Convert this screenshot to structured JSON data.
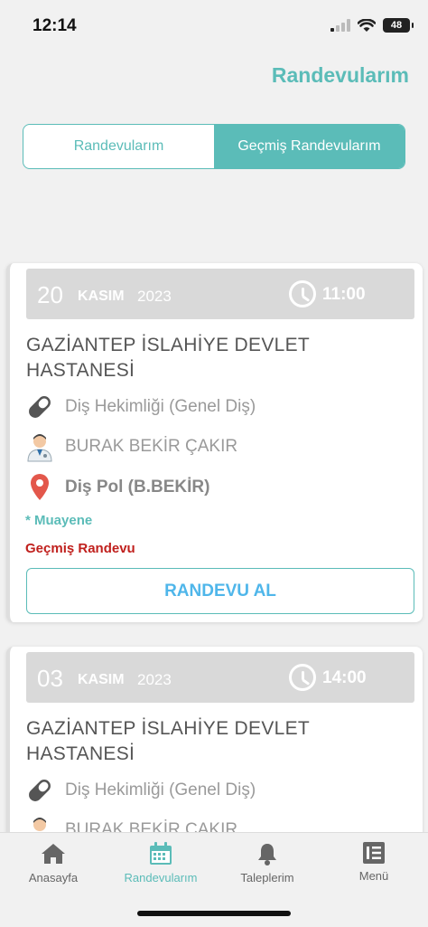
{
  "status_bar": {
    "time": "12:14",
    "battery": "48"
  },
  "page": {
    "title": "Randevularım"
  },
  "segmented": {
    "tab1": "Randevularım",
    "tab2": "Geçmiş Randevularım"
  },
  "appointments": [
    {
      "day": "20",
      "month": "KASIM",
      "year": "2023",
      "time": "11:00",
      "hospital": "GAZİANTEP İSLAHİYE DEVLET HASTANESİ",
      "department": "Diş Hekimliği (Genel Diş)",
      "doctor": "BURAK BEKİR ÇAKIR",
      "location": "Diş Pol (B.BEKİR)",
      "exam_tag": "* Muayene",
      "status": "Geçmiş Randevu",
      "cta": "RANDEVU AL"
    },
    {
      "day": "03",
      "month": "KASIM",
      "year": "2023",
      "time": "14:00",
      "hospital": "GAZİANTEP İSLAHİYE DEVLET HASTANESİ",
      "department": "Diş Hekimliği (Genel Diş)",
      "doctor": "BURAK BEKİR ÇAKIR"
    }
  ],
  "tab_bar": {
    "home": "Anasayfa",
    "appointments": "Randevularım",
    "requests": "Taleplerim",
    "menu": "Menü"
  },
  "colors": {
    "accent": "#5bbcb8",
    "past": "#c0201d",
    "cta_text": "#4fb6ea",
    "pin": "#e3574b"
  }
}
